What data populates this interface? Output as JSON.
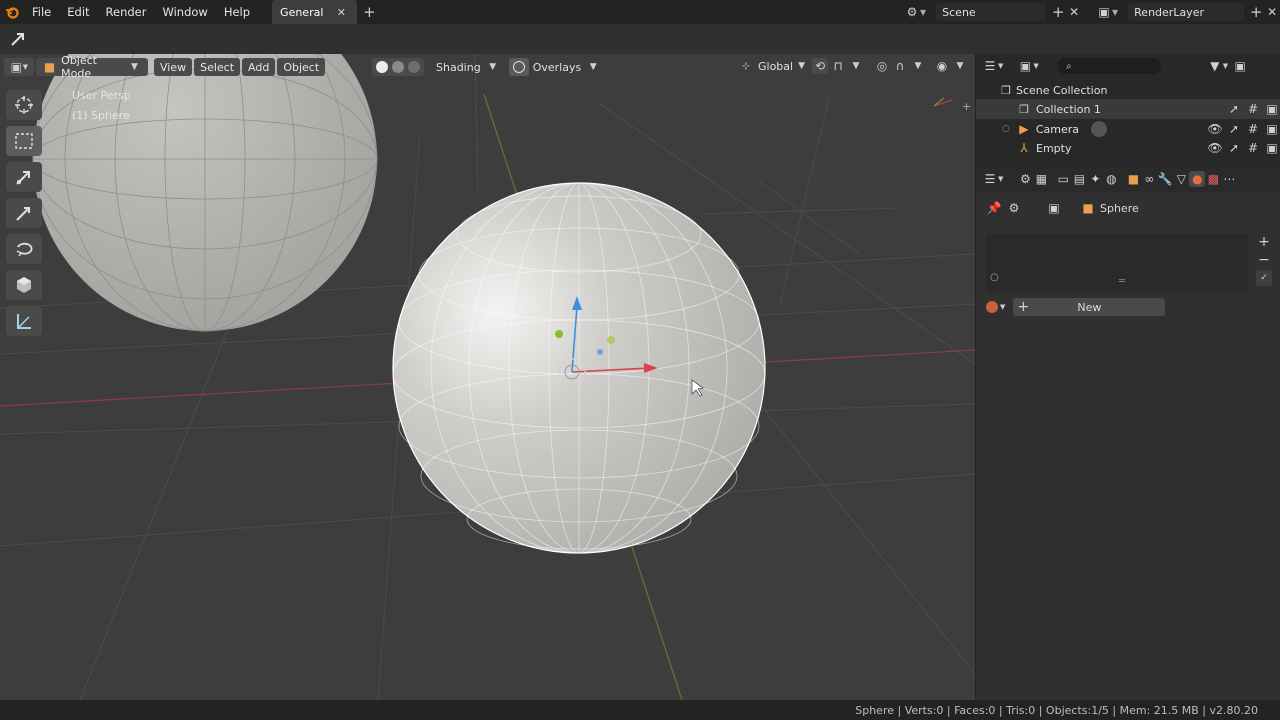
{
  "menu": {
    "items": [
      "File",
      "Edit",
      "Render",
      "Window",
      "Help"
    ],
    "workspace_tab": "General",
    "scene_label": "Scene",
    "renderlayer_label": "RenderLayer"
  },
  "viewport_header": {
    "mode": "Object Mode",
    "view": "View",
    "select": "Select",
    "add": "Add",
    "object": "Object",
    "shading": "Shading",
    "overlays": "Overlays",
    "orientation": "Global"
  },
  "viewport": {
    "perspective": "User Persp",
    "active_object": "(1) Sphere"
  },
  "tools": [
    "cursor-tool",
    "select-box-tool",
    "move-tool",
    "annotate-tool",
    "rotate-tool",
    "scale-tool",
    "measure-tool"
  ],
  "outliner": {
    "scene_collection": "Scene Collection",
    "items": [
      {
        "label": "Collection 1",
        "icon": "collection-icon"
      },
      {
        "label": "Camera",
        "icon": "camera-icon"
      },
      {
        "label": "Empty",
        "icon": "empty-icon"
      }
    ]
  },
  "properties": {
    "object_name": "Sphere",
    "new_button": "New"
  },
  "status": {
    "text": "Sphere | Verts:0 | Faces:0 | Tris:0 | Objects:1/5 | Mem: 21.5 MB | v2.80.20"
  },
  "colors": {
    "accent": "#e87d0d",
    "x_axis": "#c83c50",
    "y_axis": "#8aa52c",
    "z_axis": "#4a8fd8"
  }
}
